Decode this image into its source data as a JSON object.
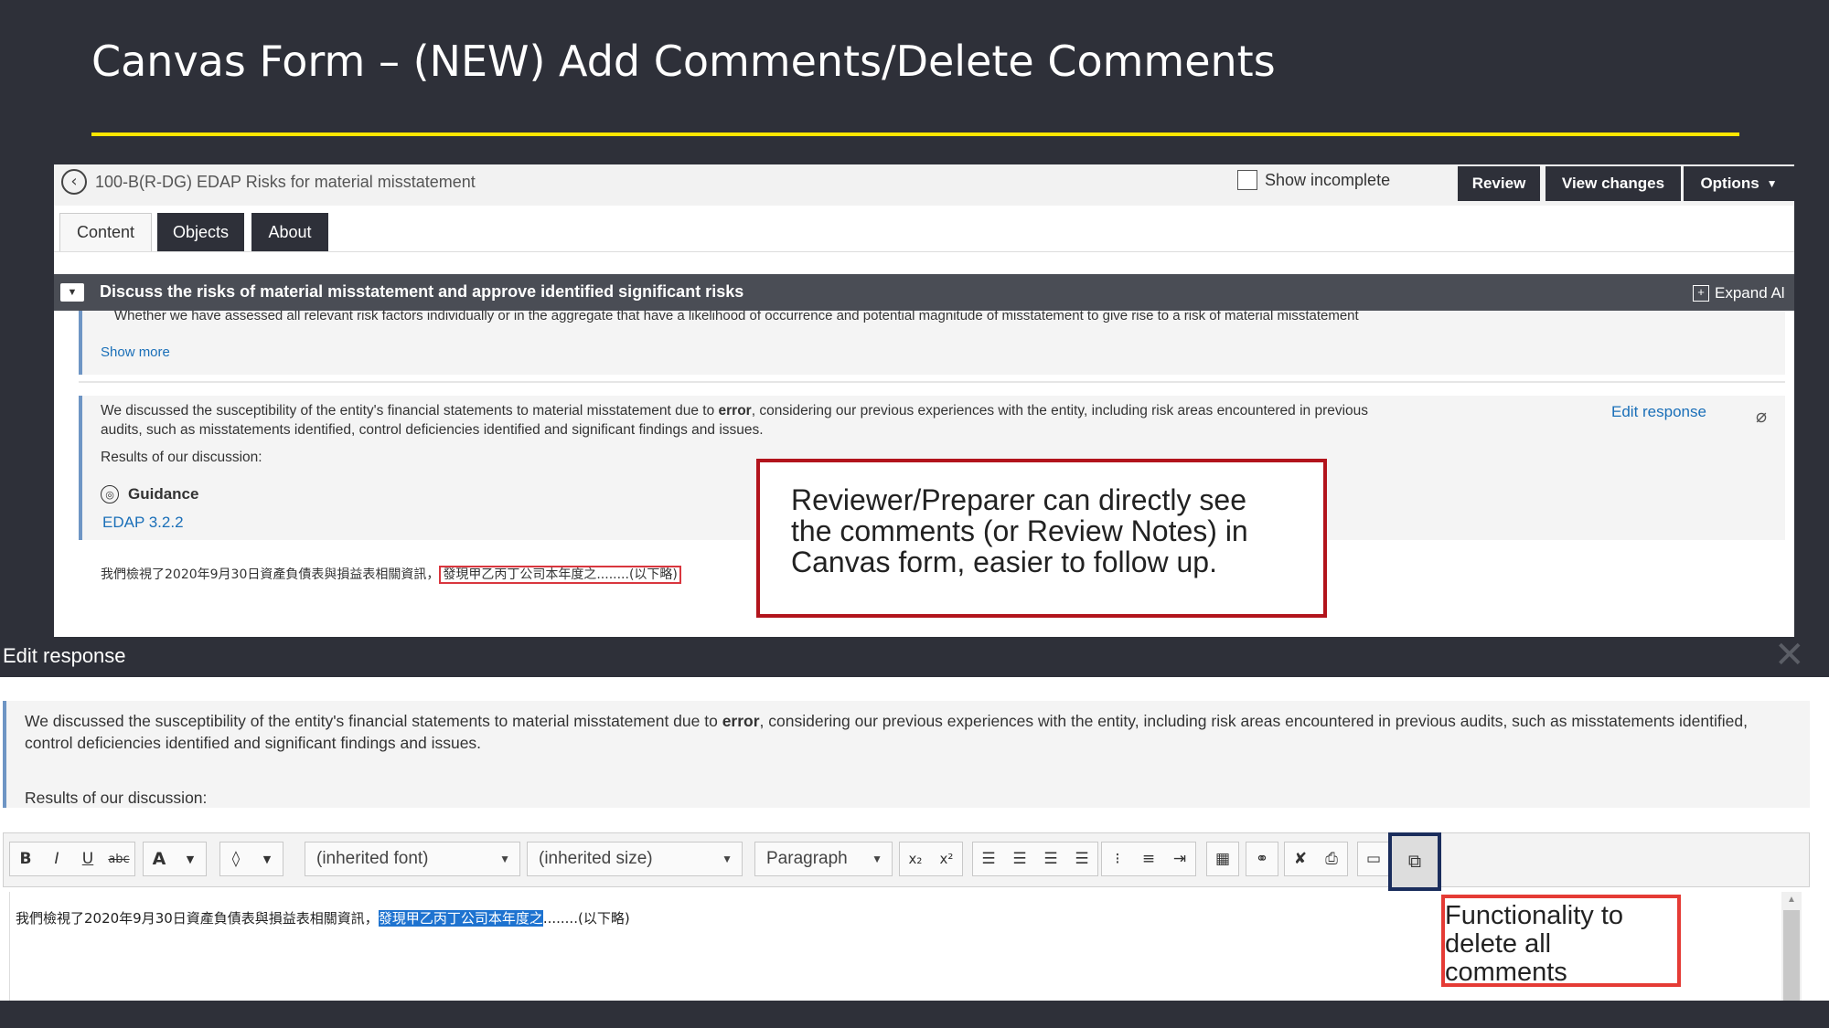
{
  "slide": {
    "title": "Canvas Form – (NEW) Add Comments/Delete Comments"
  },
  "form": {
    "title": "100-B(R-DG) EDAP Risks for material misstatement",
    "show_incomplete_label": "Show incomplete",
    "buttons": {
      "review": "Review",
      "view_changes": "View changes",
      "options": "Options"
    },
    "tabs": [
      {
        "label": "Content",
        "active": true
      },
      {
        "label": "Objects",
        "active": false
      },
      {
        "label": "About",
        "active": false
      }
    ],
    "section": {
      "title": "Discuss the risks of material misstatement and approve identified significant risks",
      "expand_all": "Expand Al"
    },
    "bullet_text": "Whether we have assessed all relevant risk factors individually or in the aggregate that have a likelihood of occurrence and potential magnitude of misstatement to give rise to a risk of material misstatement",
    "show_more": "Show more",
    "response": {
      "text_before": "We discussed the susceptibility of the entity's financial statements to material misstatement due to ",
      "text_bold": "error",
      "text_after": ", considering our previous experiences with the entity, including risk areas encountered in previous audits, such as misstatements identified, control deficiencies identified and significant findings and issues.",
      "results_label": "Results of our discussion:",
      "guidance_label": "Guidance",
      "guidance_link": "EDAP 3.2.2",
      "edit_link": "Edit response"
    },
    "chinese_line": {
      "plain": "我們檢視了2020年9月30日資產負債表與損益表相關資訊，",
      "commented": "發現甲乙丙丁公司本年度之........(以下略)"
    }
  },
  "callouts": {
    "reviewer_note": "Reviewer/Preparer can directly see the comments (or Review Notes) in Canvas form, easier to follow up.",
    "delete_note": "Functionality to delete all comments"
  },
  "edit_dialog": {
    "title": "Edit response",
    "desc_before": "We discussed the susceptibility of the entity's financial statements to material misstatement due to ",
    "desc_bold": "error",
    "desc_after": ", considering our previous experiences with the entity, including risk areas encountered in previous audits, such as misstatements identified, control deficiencies identified and significant findings and issues.",
    "results_label": "Results of our discussion:",
    "toolbar": {
      "bold": "B",
      "italic": "I",
      "underline": "U",
      "strike": "abc",
      "font_color": "A",
      "font": "(inherited font)",
      "size": "(inherited size)",
      "paragraph": "Paragraph",
      "subscript": "x₂",
      "superscript": "x²"
    },
    "editor": {
      "plain": "我們檢視了2020年9月30日資產負債表與損益表相關資訊，",
      "selected": "發現甲乙丙丁公司本年度之",
      "after": "........(以下略)"
    }
  },
  "colors": {
    "background": "#2e3039",
    "accent_rule": "#ffe600",
    "callout_red": "#b2141c",
    "delete_highlight": "#1a2d5c",
    "link": "#1a6fb8"
  }
}
